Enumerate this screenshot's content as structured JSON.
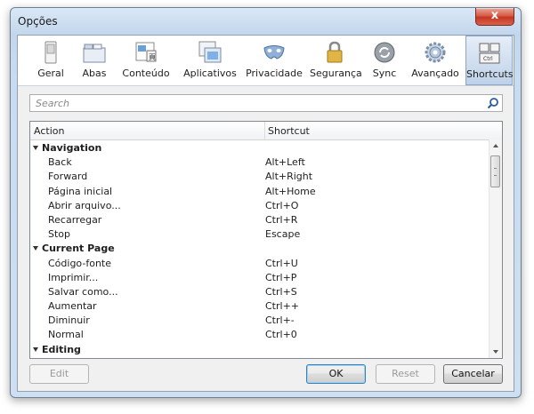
{
  "window": {
    "title": "Opções",
    "close_symbol": "x"
  },
  "toolbar": {
    "items": [
      {
        "label": "Geral",
        "icon": "switch-icon"
      },
      {
        "label": "Abas",
        "icon": "tabs-icon"
      },
      {
        "label": "Conteúdo",
        "icon": "content-icon"
      },
      {
        "label": "Aplicativos",
        "icon": "applications-icon"
      },
      {
        "label": "Privacidade",
        "icon": "mask-icon"
      },
      {
        "label": "Segurança",
        "icon": "padlock-icon"
      },
      {
        "label": "Sync",
        "icon": "sync-icon"
      },
      {
        "label": "Avançado",
        "icon": "gear-icon"
      },
      {
        "label": "Shortcuts",
        "icon": "keyboard-icon",
        "selected": true
      }
    ]
  },
  "search": {
    "placeholder": "Search",
    "value": ""
  },
  "tree": {
    "columns": {
      "action": "Action",
      "shortcut": "Shortcut"
    },
    "rows": [
      {
        "type": "group",
        "action": "Navigation",
        "shortcut": ""
      },
      {
        "type": "item",
        "action": "Back",
        "shortcut": "Alt+Left"
      },
      {
        "type": "item",
        "action": "Forward",
        "shortcut": "Alt+Right"
      },
      {
        "type": "item",
        "action": "Página inicial",
        "shortcut": "Alt+Home"
      },
      {
        "type": "item",
        "action": "Abrir arquivo...",
        "shortcut": "Ctrl+O"
      },
      {
        "type": "item",
        "action": "Recarregar",
        "shortcut": "Ctrl+R"
      },
      {
        "type": "item",
        "action": "Stop",
        "shortcut": "Escape"
      },
      {
        "type": "group",
        "action": "Current Page",
        "shortcut": ""
      },
      {
        "type": "item",
        "action": "Código-fonte",
        "shortcut": "Ctrl+U"
      },
      {
        "type": "item",
        "action": "Imprimir...",
        "shortcut": "Ctrl+P"
      },
      {
        "type": "item",
        "action": "Salvar como...",
        "shortcut": "Ctrl+S"
      },
      {
        "type": "item",
        "action": "Aumentar",
        "shortcut": "Ctrl++"
      },
      {
        "type": "item",
        "action": "Diminuir",
        "shortcut": "Ctrl+-"
      },
      {
        "type": "item",
        "action": "Normal",
        "shortcut": "Ctrl+0"
      },
      {
        "type": "group",
        "action": "Editing",
        "shortcut": ""
      }
    ]
  },
  "buttons": {
    "edit": "Edit",
    "ok": "OK",
    "reset": "Reset",
    "cancel": "Cancelar"
  }
}
